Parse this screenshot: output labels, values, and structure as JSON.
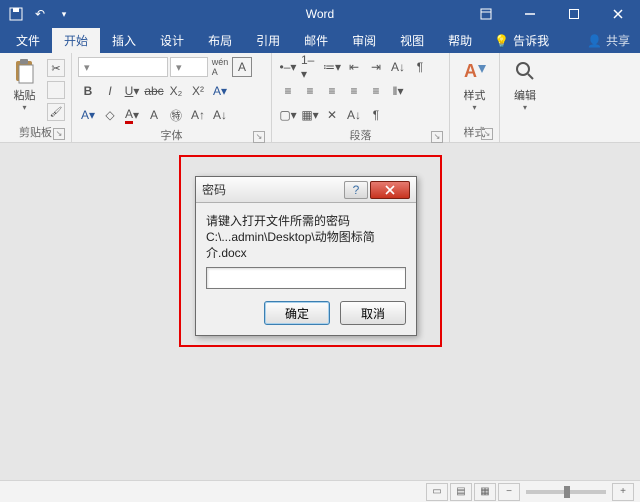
{
  "app": {
    "title": "Word"
  },
  "tabs": {
    "file": "文件",
    "home": "开始",
    "insert": "插入",
    "design": "设计",
    "layout": "布局",
    "references": "引用",
    "mailings": "邮件",
    "review": "审阅",
    "view": "视图",
    "help": "帮助",
    "tellme": "告诉我",
    "share": "共享"
  },
  "ribbon": {
    "clipboard": {
      "paste": "粘贴",
      "label": "剪贴板"
    },
    "font": {
      "label": "字体"
    },
    "paragraph": {
      "label": "段落"
    },
    "styles": {
      "btn": "样式",
      "label": "样式"
    },
    "editing": {
      "btn": "编辑",
      "label": ""
    }
  },
  "dialog": {
    "title": "密码",
    "prompt": "请键入打开文件所需的密码",
    "path": "C:\\...admin\\Desktop\\动物图标简介.docx",
    "ok": "确定",
    "cancel": "取消"
  },
  "status": {
    "zoom_minus": "−",
    "zoom_plus": "+"
  }
}
